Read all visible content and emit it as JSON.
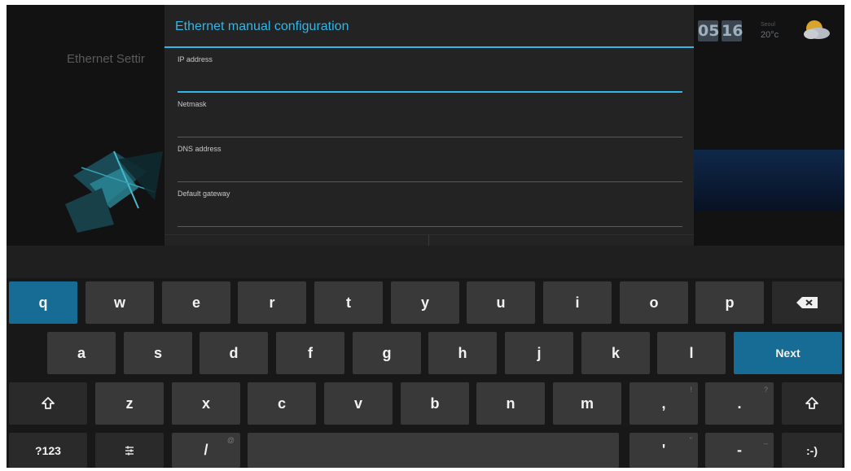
{
  "background": {
    "screen_title": "Ethernet Settir",
    "clock": {
      "hours": "05",
      "minutes": "16"
    },
    "weather": {
      "label": "Seoul",
      "temperature": "20°c",
      "icon": "cloud-sun-icon"
    }
  },
  "dialog": {
    "title": "Ethernet manual configuration",
    "fields": [
      {
        "label": "IP address",
        "value": "",
        "focused": true
      },
      {
        "label": "Netmask",
        "value": ""
      },
      {
        "label": "DNS address",
        "value": ""
      },
      {
        "label": "Default gateway",
        "value": ""
      }
    ]
  },
  "keyboard": {
    "row1": [
      "q",
      "w",
      "e",
      "r",
      "t",
      "y",
      "u",
      "i",
      "o",
      "p"
    ],
    "row2": [
      "a",
      "s",
      "d",
      "f",
      "g",
      "h",
      "j",
      "k",
      "l"
    ],
    "row3": [
      "z",
      "x",
      "c",
      "v",
      "b",
      "n",
      "m",
      ",",
      "."
    ],
    "row3_hints": {
      "comma": "!",
      "period": "?"
    },
    "row4": {
      "symbols": "?123",
      "settings_icon": "keyboard-settings-icon",
      "slash": "/",
      "slash_hint": "@",
      "apostrophe": "'",
      "apostrophe_hint": "\"",
      "dash": "-",
      "dash_hint": "_",
      "smiley": ":-)"
    },
    "next_label": "Next",
    "backspace_icon": "backspace-icon",
    "shift_icon": "shift-arrow-icon",
    "colors": {
      "accent": "#33b5e5",
      "active_key": "#166c94",
      "key": "#393939",
      "dark_key": "#2a2a2a"
    }
  }
}
